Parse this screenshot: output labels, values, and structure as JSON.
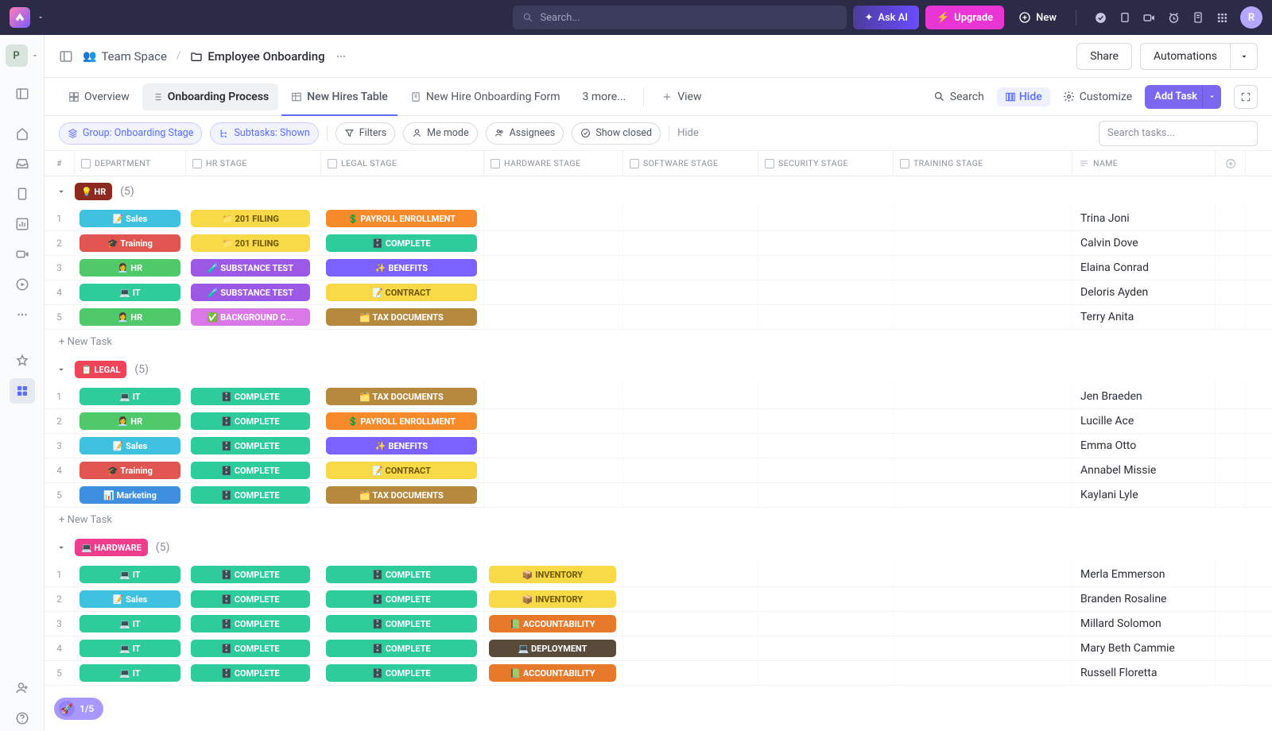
{
  "topbar": {
    "search_placeholder": "Search...",
    "ask_label": "Ask AI",
    "upgrade_label": "Upgrade",
    "new_label": "New",
    "avatar_initial": "R"
  },
  "leftnav": {
    "workspace_initial": "P"
  },
  "breadcrumb": {
    "space": "Team Space",
    "folder": "Employee Onboarding",
    "share": "Share",
    "automations": "Automations"
  },
  "views": {
    "tabs": [
      "Overview",
      "Onboarding Process",
      "New Hires Table",
      "New Hire Onboarding Form",
      "3 more...",
      "View"
    ],
    "search": "Search",
    "hide": "Hide",
    "customize": "Customize",
    "add_task": "Add Task"
  },
  "filters": {
    "group": "Group: Onboarding Stage",
    "subtasks": "Subtasks: Shown",
    "filters": "Filters",
    "me": "Me mode",
    "assignees": "Assignees",
    "closed": "Show closed",
    "hidebtn": "Hide",
    "search_placeholder": "Search tasks..."
  },
  "columns": [
    "#",
    "DEPARTMENT",
    "HR STAGE",
    "LEGAL STAGE",
    "HARDWARE STAGE",
    "SOFTWARE STAGE",
    "SECURITY STAGE",
    "TRAINING STAGE",
    "NAME"
  ],
  "newtask_label": "+ New Task",
  "progress_label": "1/5",
  "groups": [
    {
      "label": "HR",
      "emoji": "💡",
      "count": "(5)",
      "color": "g-hr",
      "rows": [
        {
          "n": "1",
          "dept": {
            "t": "📝 Sales",
            "c": "c-cyan"
          },
          "hr": {
            "t": "📁 201 FILING",
            "c": "c-yellow"
          },
          "legal": {
            "t": "💲 PAYROLL ENROLLMENT",
            "c": "c-orange"
          },
          "hw": null,
          "name": "Trina Joni"
        },
        {
          "n": "2",
          "dept": {
            "t": "🎓 Training",
            "c": "c-red"
          },
          "hr": {
            "t": "📁 201 FILING",
            "c": "c-yellow"
          },
          "legal": {
            "t": "🗄️ COMPLETE",
            "c": "c-teal"
          },
          "hw": null,
          "name": "Calvin Dove"
        },
        {
          "n": "3",
          "dept": {
            "t": "👩‍💼 HR",
            "c": "c-green"
          },
          "hr": {
            "t": "🧪 SUBSTANCE TEST",
            "c": "c-purple"
          },
          "legal": {
            "t": "✨ BENEFITS",
            "c": "c-violet"
          },
          "hw": null,
          "name": "Elaina Conrad"
        },
        {
          "n": "4",
          "dept": {
            "t": "💻 IT",
            "c": "c-teal"
          },
          "hr": {
            "t": "🧪 SUBSTANCE TEST",
            "c": "c-purple"
          },
          "legal": {
            "t": "📝 CONTRACT",
            "c": "c-yellow"
          },
          "hw": null,
          "name": "Deloris Ayden"
        },
        {
          "n": "5",
          "dept": {
            "t": "👩‍💼 HR",
            "c": "c-green"
          },
          "hr": {
            "t": "✅ BACKGROUND C...",
            "c": "c-pink"
          },
          "legal": {
            "t": "🗂️ TAX DOCUMENTS",
            "c": "c-brown"
          },
          "hw": null,
          "name": "Terry Anita"
        }
      ]
    },
    {
      "label": "LEGAL",
      "emoji": "📋",
      "count": "(5)",
      "color": "g-legal",
      "rows": [
        {
          "n": "1",
          "dept": {
            "t": "💻 IT",
            "c": "c-teal"
          },
          "hr": {
            "t": "🗄️ COMPLETE",
            "c": "c-teal"
          },
          "legal": {
            "t": "🗂️ TAX DOCUMENTS",
            "c": "c-brown"
          },
          "hw": null,
          "name": "Jen Braeden"
        },
        {
          "n": "2",
          "dept": {
            "t": "👩‍💼 HR",
            "c": "c-green"
          },
          "hr": {
            "t": "🗄️ COMPLETE",
            "c": "c-teal"
          },
          "legal": {
            "t": "💲 PAYROLL ENROLLMENT",
            "c": "c-orange"
          },
          "hw": null,
          "name": "Lucille Ace"
        },
        {
          "n": "3",
          "dept": {
            "t": "📝 Sales",
            "c": "c-cyan"
          },
          "hr": {
            "t": "🗄️ COMPLETE",
            "c": "c-teal"
          },
          "legal": {
            "t": "✨ BENEFITS",
            "c": "c-violet"
          },
          "hw": null,
          "name": "Emma Otto"
        },
        {
          "n": "4",
          "dept": {
            "t": "🎓 Training",
            "c": "c-red"
          },
          "hr": {
            "t": "🗄️ COMPLETE",
            "c": "c-teal"
          },
          "legal": {
            "t": "📝 CONTRACT",
            "c": "c-yellow"
          },
          "hw": null,
          "name": "Annabel Missie"
        },
        {
          "n": "5",
          "dept": {
            "t": "📊 Marketing",
            "c": "c-blue"
          },
          "hr": {
            "t": "🗄️ COMPLETE",
            "c": "c-teal"
          },
          "legal": {
            "t": "🗂️ TAX DOCUMENTS",
            "c": "c-brown"
          },
          "hw": null,
          "name": "Kaylani Lyle"
        }
      ]
    },
    {
      "label": "HARDWARE",
      "emoji": "💻",
      "count": "(5)",
      "color": "g-hw",
      "rows": [
        {
          "n": "1",
          "dept": {
            "t": "💻 IT",
            "c": "c-teal"
          },
          "hr": {
            "t": "🗄️ COMPLETE",
            "c": "c-teal"
          },
          "legal": {
            "t": "🗄️ COMPLETE",
            "c": "c-teal"
          },
          "hw": {
            "t": "📦 INVENTORY",
            "c": "c-yellow"
          },
          "name": "Merla Emmerson"
        },
        {
          "n": "2",
          "dept": {
            "t": "📝 Sales",
            "c": "c-cyan"
          },
          "hr": {
            "t": "🗄️ COMPLETE",
            "c": "c-teal"
          },
          "legal": {
            "t": "🗄️ COMPLETE",
            "c": "c-teal"
          },
          "hw": {
            "t": "📦 INVENTORY",
            "c": "c-yellow"
          },
          "name": "Branden Rosaline"
        },
        {
          "n": "3",
          "dept": {
            "t": "💻 IT",
            "c": "c-teal"
          },
          "hr": {
            "t": "🗄️ COMPLETE",
            "c": "c-teal"
          },
          "legal": {
            "t": "🗄️ COMPLETE",
            "c": "c-teal"
          },
          "hw": {
            "t": "📗 ACCOUNTABILITY",
            "c": "c-dorange"
          },
          "name": "Millard Solomon"
        },
        {
          "n": "4",
          "dept": {
            "t": "💻 IT",
            "c": "c-teal"
          },
          "hr": {
            "t": "🗄️ COMPLETE",
            "c": "c-teal"
          },
          "legal": {
            "t": "🗄️ COMPLETE",
            "c": "c-teal"
          },
          "hw": {
            "t": "💻 DEPLOYMENT",
            "c": "c-dark"
          },
          "name": "Mary Beth Cammie"
        },
        {
          "n": "5",
          "dept": {
            "t": "💻 IT",
            "c": "c-teal"
          },
          "hr": {
            "t": "🗄️ COMPLETE",
            "c": "c-teal"
          },
          "legal": {
            "t": "🗄️ COMPLETE",
            "c": "c-teal"
          },
          "hw": {
            "t": "📗 ACCOUNTABILITY",
            "c": "c-dorange"
          },
          "name": "Russell Floretta"
        }
      ]
    }
  ]
}
